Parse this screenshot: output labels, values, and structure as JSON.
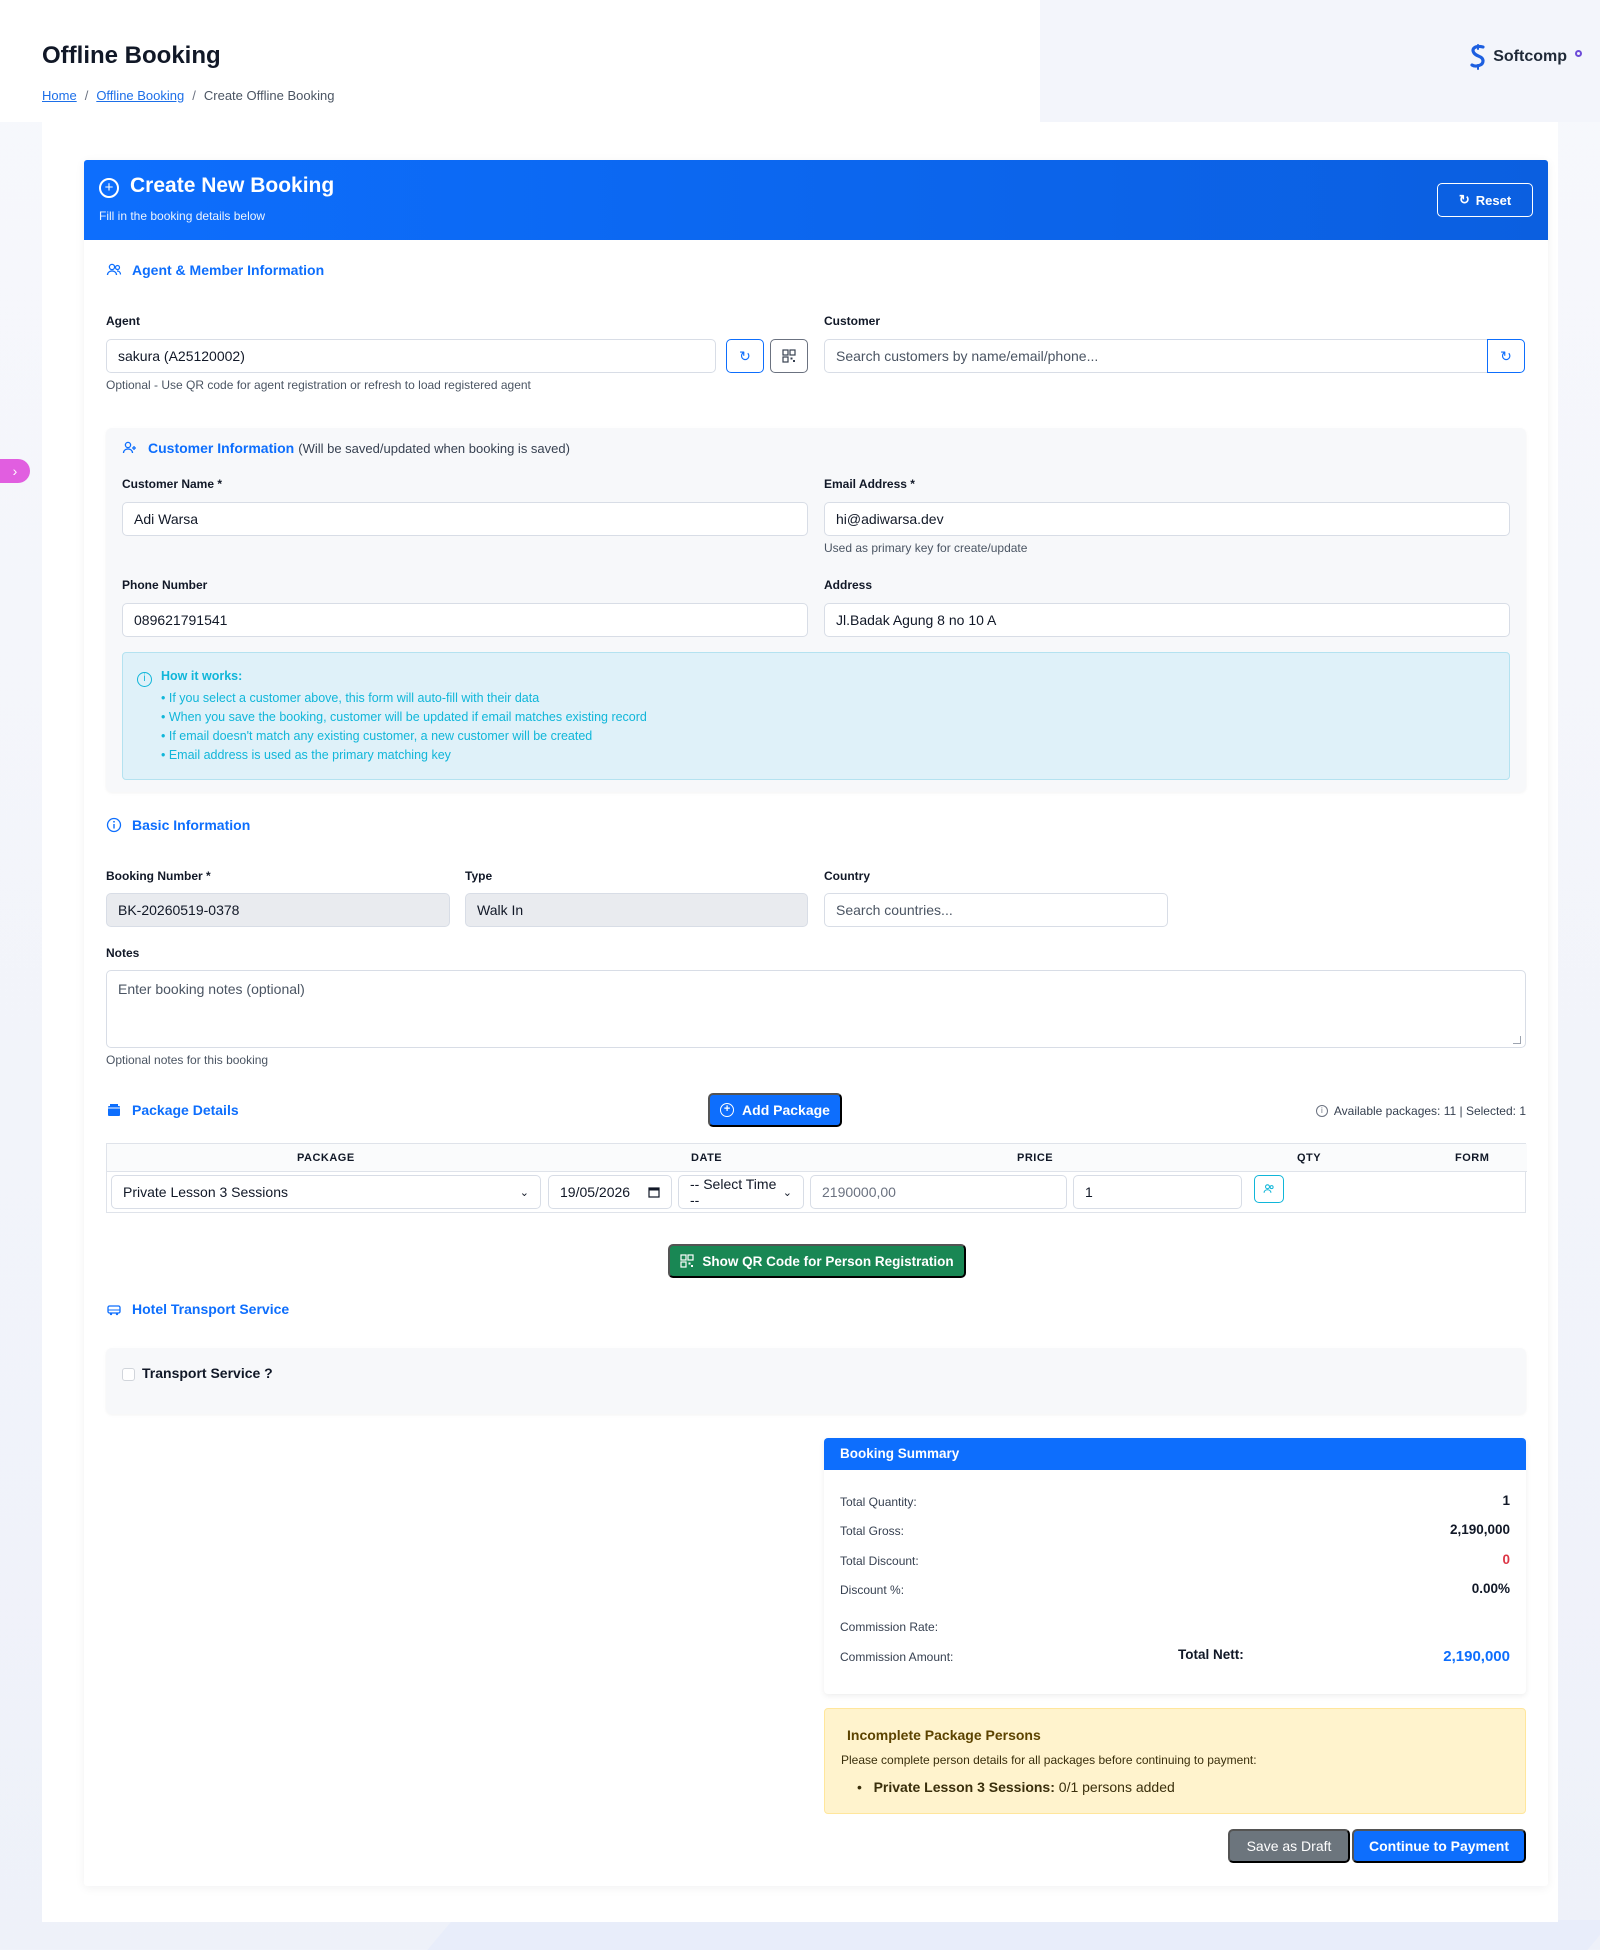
{
  "page": {
    "title": "Offline Booking"
  },
  "breadcrumb": {
    "home": "Home",
    "parent": "Offline Booking",
    "current": "Create Offline Booking",
    "separator": "/"
  },
  "logo": {
    "text": "Softcomp"
  },
  "header": {
    "title": "Create New Booking",
    "subtitle": "Fill in the booking details below",
    "reset_label": "Reset"
  },
  "agent_section": {
    "title": "Agent & Member Information",
    "agent_label": "Agent",
    "agent_value": "sakura (A25120002)",
    "agent_help": "Optional - Use QR code for agent registration or refresh to load registered agent",
    "customer_label": "Customer",
    "customer_placeholder": "Search customers by name/email/phone..."
  },
  "customer_info": {
    "title": "Customer Information",
    "subtitle": "(Will be saved/updated when booking is saved)",
    "name_label": "Customer Name *",
    "name_value": "Adi Warsa",
    "email_label": "Email Address *",
    "email_value": "hi@adiwarsa.dev",
    "email_help": "Used as primary key for create/update",
    "phone_label": "Phone Number",
    "phone_value": "089621791541",
    "address_label": "Address",
    "address_value": "Jl.Badak Agung 8 no 10 A",
    "how_title": "How it works:",
    "how_items": [
      "• If you select a customer above, this form will auto-fill with their data",
      "• When you save the booking, customer will be updated if email matches existing record",
      "• If email doesn't match any existing customer, a new customer will be created",
      "• Email address is used as the primary matching key"
    ]
  },
  "basic": {
    "title": "Basic Information",
    "booking_label": "Booking Number *",
    "booking_value": "BK-20260519-0378",
    "type_label": "Type",
    "type_value": "Walk In",
    "country_label": "Country",
    "country_placeholder": "Search countries...",
    "notes_label": "Notes",
    "notes_placeholder": "Enter booking notes (optional)",
    "notes_help": "Optional notes for this booking"
  },
  "packages": {
    "title": "Package Details",
    "add_label": "Add Package",
    "available_text": "Available packages: 11 | Selected: 1",
    "columns": [
      "PACKAGE",
      "DATE",
      "PRICE",
      "QTY",
      "FORM"
    ],
    "row": {
      "package": "Private Lesson 3 Sessions",
      "date": "19/05/2026",
      "time": "-- Select Time --",
      "price": "2190000,00",
      "qty": "1"
    },
    "qr_label": "Show QR Code for Person Registration"
  },
  "transport": {
    "title": "Hotel Transport Service",
    "checkbox_label": "Transport Service ?"
  },
  "summary": {
    "title": "Booking Summary",
    "total_quantity_label": "Total Quantity:",
    "total_quantity": "1",
    "total_gross_label": "Total Gross:",
    "total_gross": "2,190,000",
    "total_discount_label": "Total Discount:",
    "total_discount": "0",
    "discount_pct_label": "Discount %:",
    "discount_pct": "0.00%",
    "commission_rate_label": "Commission Rate:",
    "commission_amount_label": "Commission Amount:",
    "total_nett_label": "Total Nett:",
    "total_nett": "2,190,000",
    "discount_color": "#dc3545",
    "nett_color": "#0d6efd"
  },
  "warning": {
    "title": "Incomplete Package Persons",
    "desc": "Please complete person details for all packages before continuing to payment:",
    "item_name": "Private Lesson 3 Sessions:",
    "item_status": " 0/1 persons added"
  },
  "actions": {
    "draft_label": "Save as Draft",
    "pay_label": "Continue to Payment"
  },
  "colors": {
    "primary": "#0d6efd",
    "success": "#198754",
    "secondary": "#6c757d",
    "info": "#10b6d9"
  }
}
